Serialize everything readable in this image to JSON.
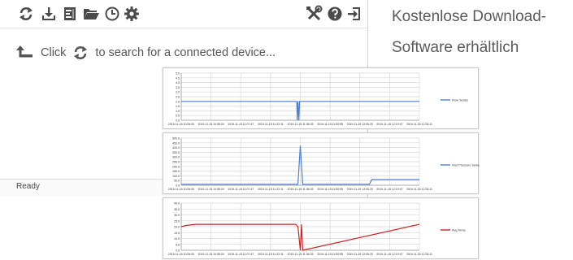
{
  "caption": {
    "line1": "Kostenlose Download-",
    "line2": "Software erhältlich"
  },
  "toolbar": {
    "left_icons": [
      "refresh-icon",
      "download-icon",
      "file-icon",
      "folder-open-icon",
      "clock-icon",
      "gear-icon"
    ],
    "right_icons": [
      "tools-icon",
      "help-icon",
      "exit-icon"
    ]
  },
  "hint": {
    "before": "Click",
    "after": "to search for a connected device..."
  },
  "status": {
    "text": "Ready"
  },
  "colors": {
    "icon": "#4a4a4a",
    "series_blue": "#4f7fcf",
    "series_red": "#cc2222",
    "grid": "#d9d9d9"
  },
  "chart_data": [
    {
      "type": "line",
      "ylim": [
        0,
        5.0
      ],
      "y_ticks": [
        "5.0",
        "4.5",
        "4.0",
        "3.5",
        "3.0",
        "2.5",
        "2.0",
        "1.5",
        "1.0",
        "0.5",
        "0.0"
      ],
      "x_ticks": [
        "2019-11-15 10:06:00",
        "2019-11-15 10:55:20",
        "2019-11-15 11:07:47",
        "2019-11-15 11:22:11",
        "2019-11-15 11:36:33",
        "2019-11-15 11:50:55",
        "2019-11-15 12:05:20",
        "2019-11-15 12:19:47",
        "2019-11-15 12:34:11"
      ],
      "series": [
        {
          "name": "Flow Series",
          "color": "#4f7fcf",
          "x": [
            0,
            0.485,
            0.487,
            0.49,
            0.494,
            0.497,
            0.5,
            1
          ],
          "values": [
            2.0,
            2.0,
            0.0,
            2.0,
            0.0,
            2.0,
            2.0,
            2.0
          ]
        }
      ]
    },
    {
      "type": "line",
      "ylim": [
        0,
        500
      ],
      "y_ticks": [
        "500.0",
        "450.0",
        "400.0",
        "350.0",
        "300.0",
        "250.0",
        "200.0",
        "150.0",
        "100.0",
        "50.0",
        "0.0"
      ],
      "x_ticks": [
        "2019-11-15 10:06:00",
        "2019-11-15 10:55:20",
        "2019-11-15 11:07:47",
        "2019-11-15 11:22:11",
        "2019-11-15 11:36:33",
        "2019-11-15 11:50:55",
        "2019-11-15 12:05:20",
        "2019-11-15 12:19:47",
        "2019-11-15 12:34:11"
      ],
      "series": [
        {
          "name": "Inlet Pressure Series",
          "color": "#4f7fcf",
          "x": [
            0,
            0.49,
            0.5,
            0.51,
            0.79,
            0.8,
            1
          ],
          "values": [
            10,
            10,
            420,
            10,
            10,
            60,
            60
          ]
        }
      ]
    },
    {
      "type": "line",
      "ylim": [
        0,
        40
      ],
      "y_ticks": [
        "40.0",
        "35.0",
        "30.0",
        "25.0",
        "20.0",
        "15.0",
        "10.0",
        "5.0",
        "0.0"
      ],
      "x_ticks": [
        "2019-11-15 10:06:00",
        "2019-11-15 10:55:20",
        "2019-11-15 11:07:47",
        "2019-11-15 11:22:11",
        "2019-11-15 11:36:33",
        "2019-11-15 11:50:55",
        "2019-11-15 12:05:20",
        "2019-11-15 12:19:47",
        "2019-11-15 12:34:11"
      ],
      "series": [
        {
          "name": "Avg Temp",
          "color": "#cc2222",
          "x": [
            0,
            0.02,
            0.06,
            0.48,
            0.49,
            0.5,
            0.505,
            0.51,
            1
          ],
          "values": [
            20,
            21,
            22,
            22,
            20,
            0,
            22,
            0,
            22
          ]
        }
      ]
    }
  ]
}
